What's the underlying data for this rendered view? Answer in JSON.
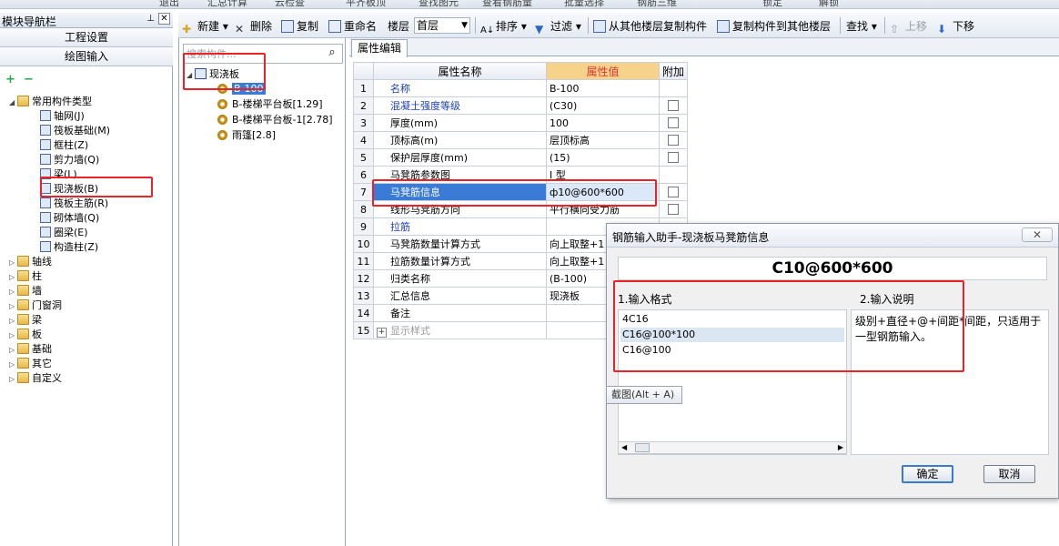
{
  "topstrip": {
    "items": [
      "退出",
      "汇总计算",
      "云检查",
      "平齐板顶",
      "查找图元",
      "查看钢筋量",
      "批量选择",
      "钢筋三维",
      "锁定",
      "解锁"
    ]
  },
  "left_panel": {
    "title": "模块导航栏",
    "pin": "ᵖ",
    "close": "✕",
    "buttons": [
      "工程设置",
      "绘图输入"
    ],
    "tree": {
      "root": "常用构件类型",
      "children": [
        "轴网(J)",
        "筏板基础(M)",
        "框柱(Z)",
        "剪力墙(Q)",
        "梁(L)",
        "现浇板(B)",
        "筏板主筋(R)",
        "砌体墙(Q)",
        "圈梁(E)",
        "构造柱(Z)"
      ],
      "folders": [
        "轴线",
        "柱",
        "墙",
        "门窗洞",
        "梁",
        "板",
        "基础",
        "其它",
        "自定义"
      ]
    }
  },
  "toolbar": {
    "new_label": "新建",
    "delete_label": "删除",
    "copy_label": "复制",
    "rename_label": "重命名",
    "floor_label": "楼层",
    "floor_value": "首层",
    "sort_label": "排序",
    "filter_label": "过滤",
    "copy_from_floor": "从其他楼层复制构件",
    "copy_to_floor": "复制构件到其他楼层",
    "find_label": "查找",
    "move_up": "上移",
    "move_down": "下移"
  },
  "mid_panel": {
    "search_placeholder": "搜索构件...",
    "root": "现浇板",
    "items": [
      "B-100",
      "B-楼梯平台板[1.29]",
      "B-楼梯平台板-1[2.78]",
      "雨篷[2.8]"
    ]
  },
  "property_editor": {
    "tab": "属性编辑",
    "headers": {
      "num": "",
      "name": "属性名称",
      "value": "属性值",
      "extra": "附加"
    },
    "rows": [
      {
        "n": "1",
        "name": "名称",
        "value": "B-100",
        "blue": true,
        "cb": false
      },
      {
        "n": "2",
        "name": "混凝土强度等级",
        "value": "(C30)",
        "blue": true,
        "cb": true
      },
      {
        "n": "3",
        "name": "厚度(mm)",
        "value": "100",
        "blue": false,
        "cb": true
      },
      {
        "n": "4",
        "name": "顶标高(m)",
        "value": "层顶标高",
        "blue": false,
        "cb": true
      },
      {
        "n": "5",
        "name": "保护层厚度(mm)",
        "value": "(15)",
        "blue": false,
        "cb": true
      },
      {
        "n": "6",
        "name": "马凳筋参数图",
        "value": "I 型",
        "blue": false,
        "cb": false
      },
      {
        "n": "7",
        "name": "马凳筋信息",
        "value": "ф10@600*600",
        "blue": false,
        "cb": true
      },
      {
        "n": "8",
        "name": "线形马凳筋方向",
        "value": "平行横向受力筋",
        "blue": false,
        "cb": true
      },
      {
        "n": "9",
        "name": "拉筋",
        "value": "",
        "blue": true,
        "cb": false
      },
      {
        "n": "10",
        "name": "马凳筋数量计算方式",
        "value": "向上取整+1",
        "blue": false,
        "cb": false
      },
      {
        "n": "11",
        "name": "拉筋数量计算方式",
        "value": "向上取整+1",
        "blue": false,
        "cb": false
      },
      {
        "n": "12",
        "name": "归类名称",
        "value": "(B-100)",
        "blue": false,
        "cb": false
      },
      {
        "n": "13",
        "name": "汇总信息",
        "value": "现浇板",
        "blue": false,
        "cb": false
      },
      {
        "n": "14",
        "name": "备注",
        "value": "",
        "blue": false,
        "cb": false
      },
      {
        "n": "15",
        "name": "显示样式",
        "value": "",
        "blue": false,
        "cb": false,
        "expand": "+"
      }
    ]
  },
  "dialog": {
    "title": "钢筋输入助手-现浇板马凳筋信息",
    "close": "✕",
    "formula": "C10@600*600",
    "format_label": "1.输入格式",
    "desc_label": "2.输入说明",
    "formats": [
      "4C16",
      "C16@100*100",
      "C16@100"
    ],
    "description": "级别+直径+@+间距*间距，只适用于一型钢筋输入。",
    "ok": "确定",
    "cancel": "取消"
  },
  "tooltip": "截图(Alt + A)"
}
